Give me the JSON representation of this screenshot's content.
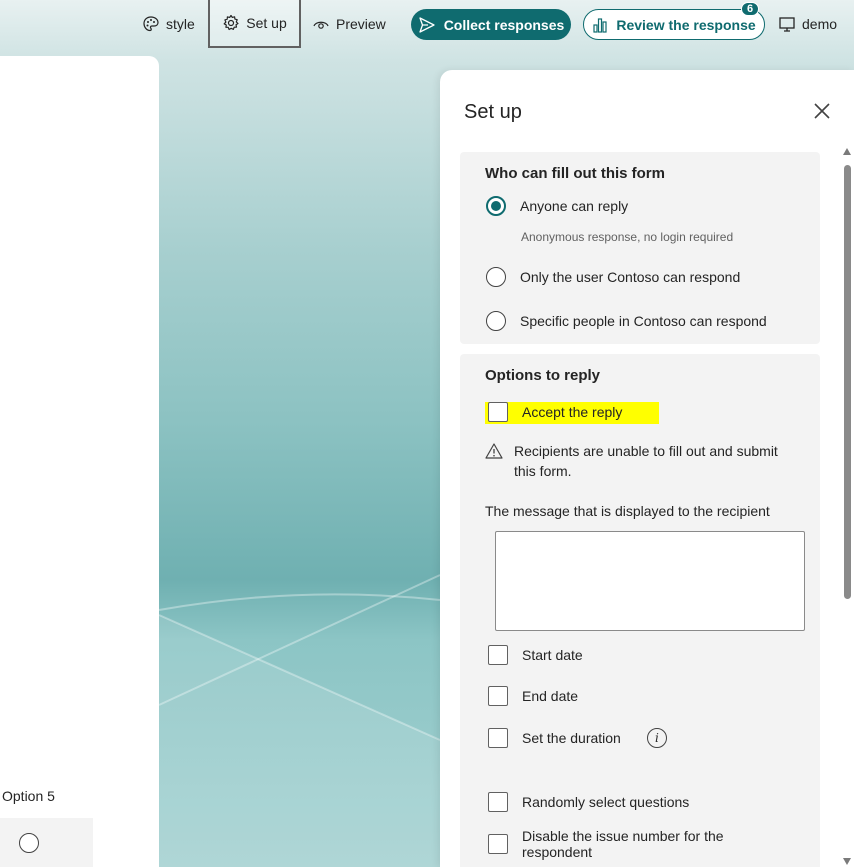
{
  "toolbar": {
    "style_label": "style",
    "setup_label": "Set up",
    "preview_label": "Preview",
    "collect_label": "Collect responses",
    "review_label": "Review the response",
    "review_badge": "6",
    "demo_label": "demo"
  },
  "form": {
    "option5_label": "Option 5"
  },
  "setup_panel": {
    "title": "Set up",
    "who_section": {
      "title": "Who can fill out this form",
      "options": [
        {
          "label": "Anyone can reply",
          "checked": true,
          "note": "Anonymous response, no login required"
        },
        {
          "label": "Only the user Contoso can respond",
          "checked": false
        },
        {
          "label": "Specific people in Contoso can respond",
          "checked": false
        }
      ]
    },
    "options_section": {
      "title": "Options to reply",
      "accept_label": "Accept the reply",
      "warning_text": "Recipients are unable to fill out and submit this form.",
      "message_label": "The message that is displayed to the recipient",
      "message_value": "",
      "start_date_label": "Start date",
      "end_date_label": "End date",
      "duration_label": "Set the duration",
      "random_label": "Randomly select questions",
      "disable_number_label": "Disable the issue number for the respondent"
    }
  },
  "colors": {
    "accent": "#0f6b6f",
    "highlight": "#ffff00"
  }
}
